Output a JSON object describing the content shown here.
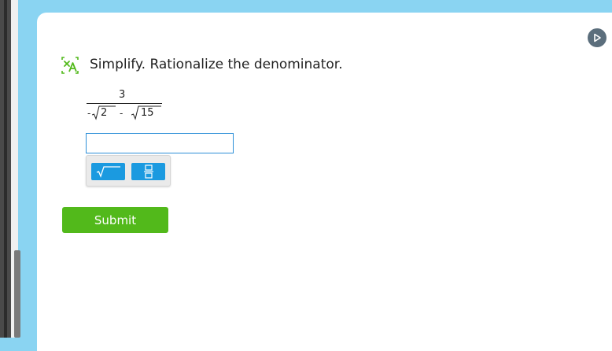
{
  "problem": {
    "instruction": "Simplify. Rationalize the denominator.",
    "expression": {
      "numerator": "3",
      "denominator_leading_sign": "-",
      "first_radicand": "2",
      "operator": "-",
      "second_radicand": "15"
    }
  },
  "answer": {
    "value": "",
    "placeholder": ""
  },
  "keypad": {
    "keys": [
      "square-root",
      "fraction"
    ]
  },
  "submit": {
    "label": "Submit"
  },
  "icons": {
    "translate": "translate-icon",
    "play": "play-icon"
  },
  "colors": {
    "background": "#8ad4f2",
    "card": "#ffffff",
    "submit": "#52b91b",
    "key": "#1b9ae0",
    "input_border": "#2d8fd8",
    "play": "#5b6e7c",
    "translate_icon": "#52b91b"
  }
}
